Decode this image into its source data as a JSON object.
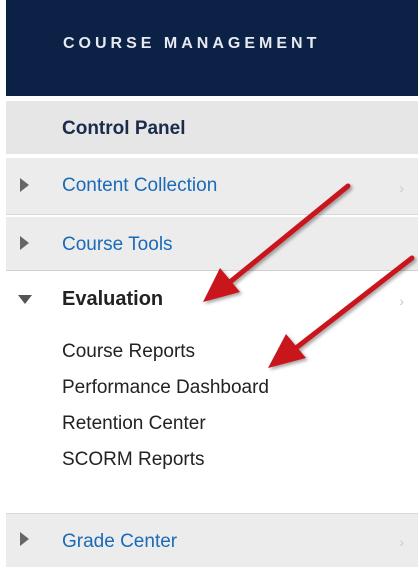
{
  "header": {
    "title": "COURSE MANAGEMENT"
  },
  "control_panel": {
    "label": "Control Panel"
  },
  "menu": {
    "content_collection": "Content Collection",
    "course_tools": "Course Tools",
    "evaluation": "Evaluation",
    "grade_center": "Grade Center"
  },
  "evaluation_items": [
    "Course Reports",
    "Performance Dashboard",
    "Retention Center",
    "SCORM Reports"
  ],
  "colors": {
    "header_bg": "#0b2146",
    "link": "#1a6ab8",
    "arrow": "#c8141c"
  }
}
